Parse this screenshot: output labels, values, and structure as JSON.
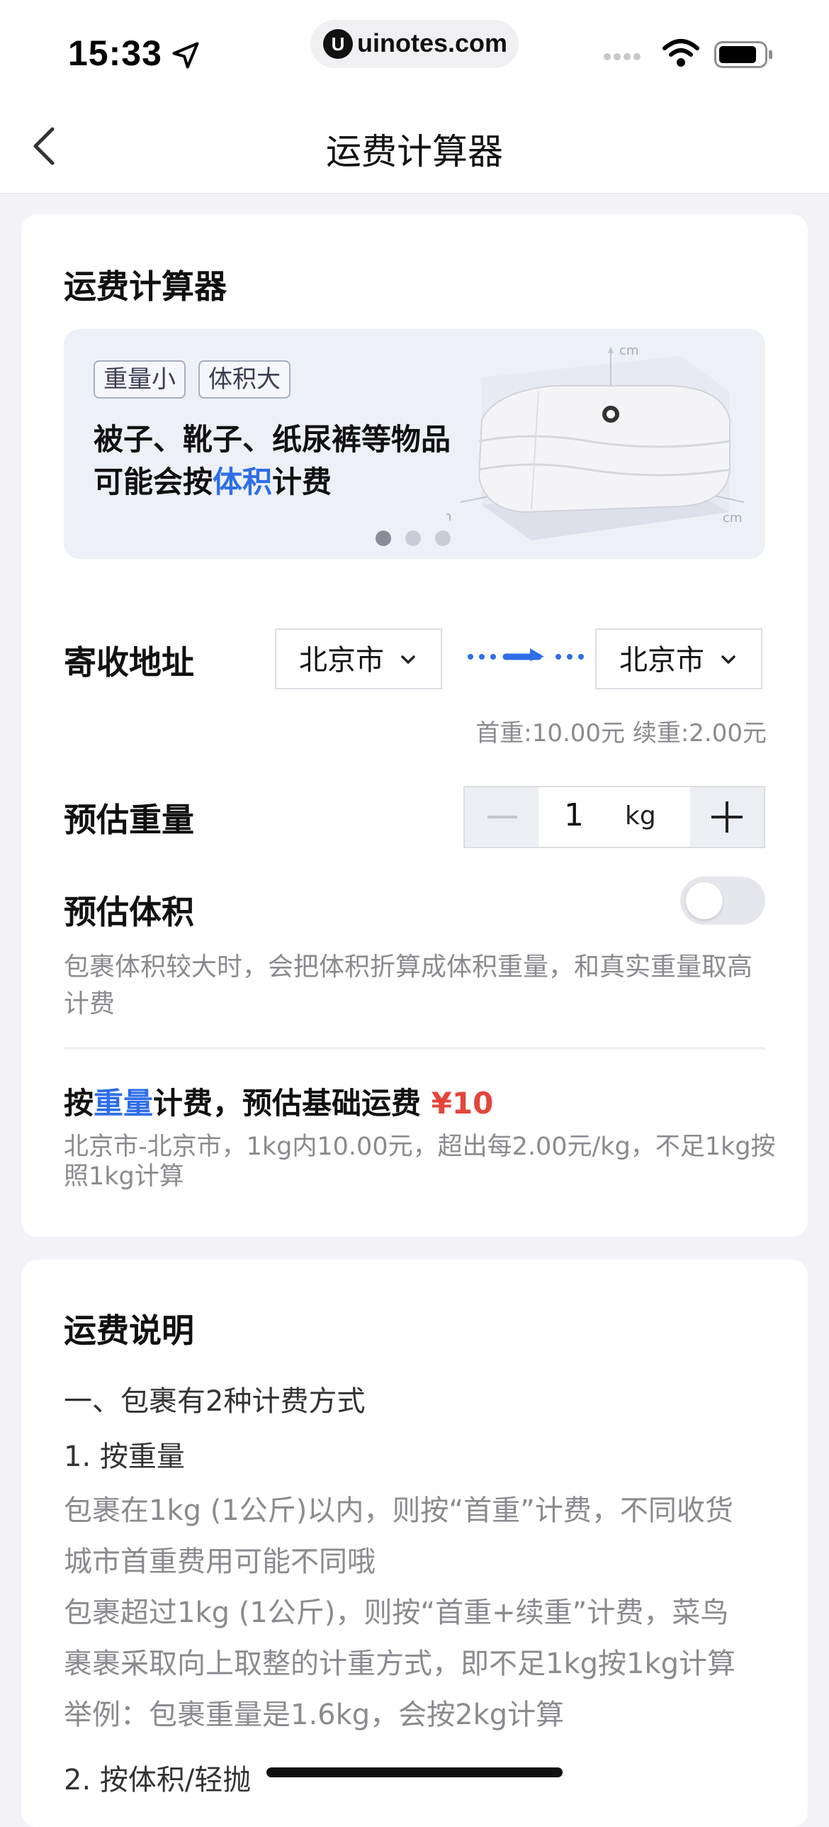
{
  "status_bar": {
    "time": "15:33",
    "url": "uinotes.com",
    "url_logo": "U"
  },
  "nav": {
    "title": "运费计算器"
  },
  "calculator": {
    "title": "运费计算器",
    "banner": {
      "tags": [
        "重量小",
        "体积大"
      ],
      "line1": "被子、靴子、纸尿裤等物品",
      "line2_prefix": "可能会按",
      "line2_highlight": "体积",
      "line2_suffix": "计费",
      "art_labels": [
        "cm",
        "cm",
        "cm"
      ],
      "carousel_count": 3,
      "carousel_active": 0
    },
    "address": {
      "label": "寄收地址",
      "from_city": "北京市",
      "to_city": "北京市",
      "fee_note": "首重:10.00元 续重:2.00元"
    },
    "weight": {
      "label": "预估重量",
      "value": "1",
      "unit": "kg"
    },
    "volume": {
      "label": "预估体积",
      "toggle_on": false,
      "description": "包裹体积较大时，会把体积折算成体积重量，和真实重量取高计费"
    },
    "estimate": {
      "prefix": "按",
      "mode": "重量",
      "middle": "计费，预估基础运费 ",
      "price": "¥10",
      "description": "北京市-北京市，1kg内10.00元，超出每2.00元/kg，不足1kg按照1kg计算"
    }
  },
  "explanation": {
    "title": "运费说明",
    "lines": [
      "一、包裹有2种计费方式",
      "1. 按重量",
      "包裹在1kg (1公斤)以内，则按“首重”计费，不同收货",
      "城市首重费用可能不同哦",
      "包裹超过1kg (1公斤)，则按“首重+续重”计费，菜鸟",
      "裹裹采取向上取整的计重方式，即不足1kg按1kg计算",
      "举例：包裹重量是1.6kg，会按2kg计算",
      "2. 按体积/轻抛"
    ]
  },
  "colors": {
    "accent_blue": "#2e6ee8",
    "price_red": "#e5453a",
    "background": "#f2f2f7"
  }
}
